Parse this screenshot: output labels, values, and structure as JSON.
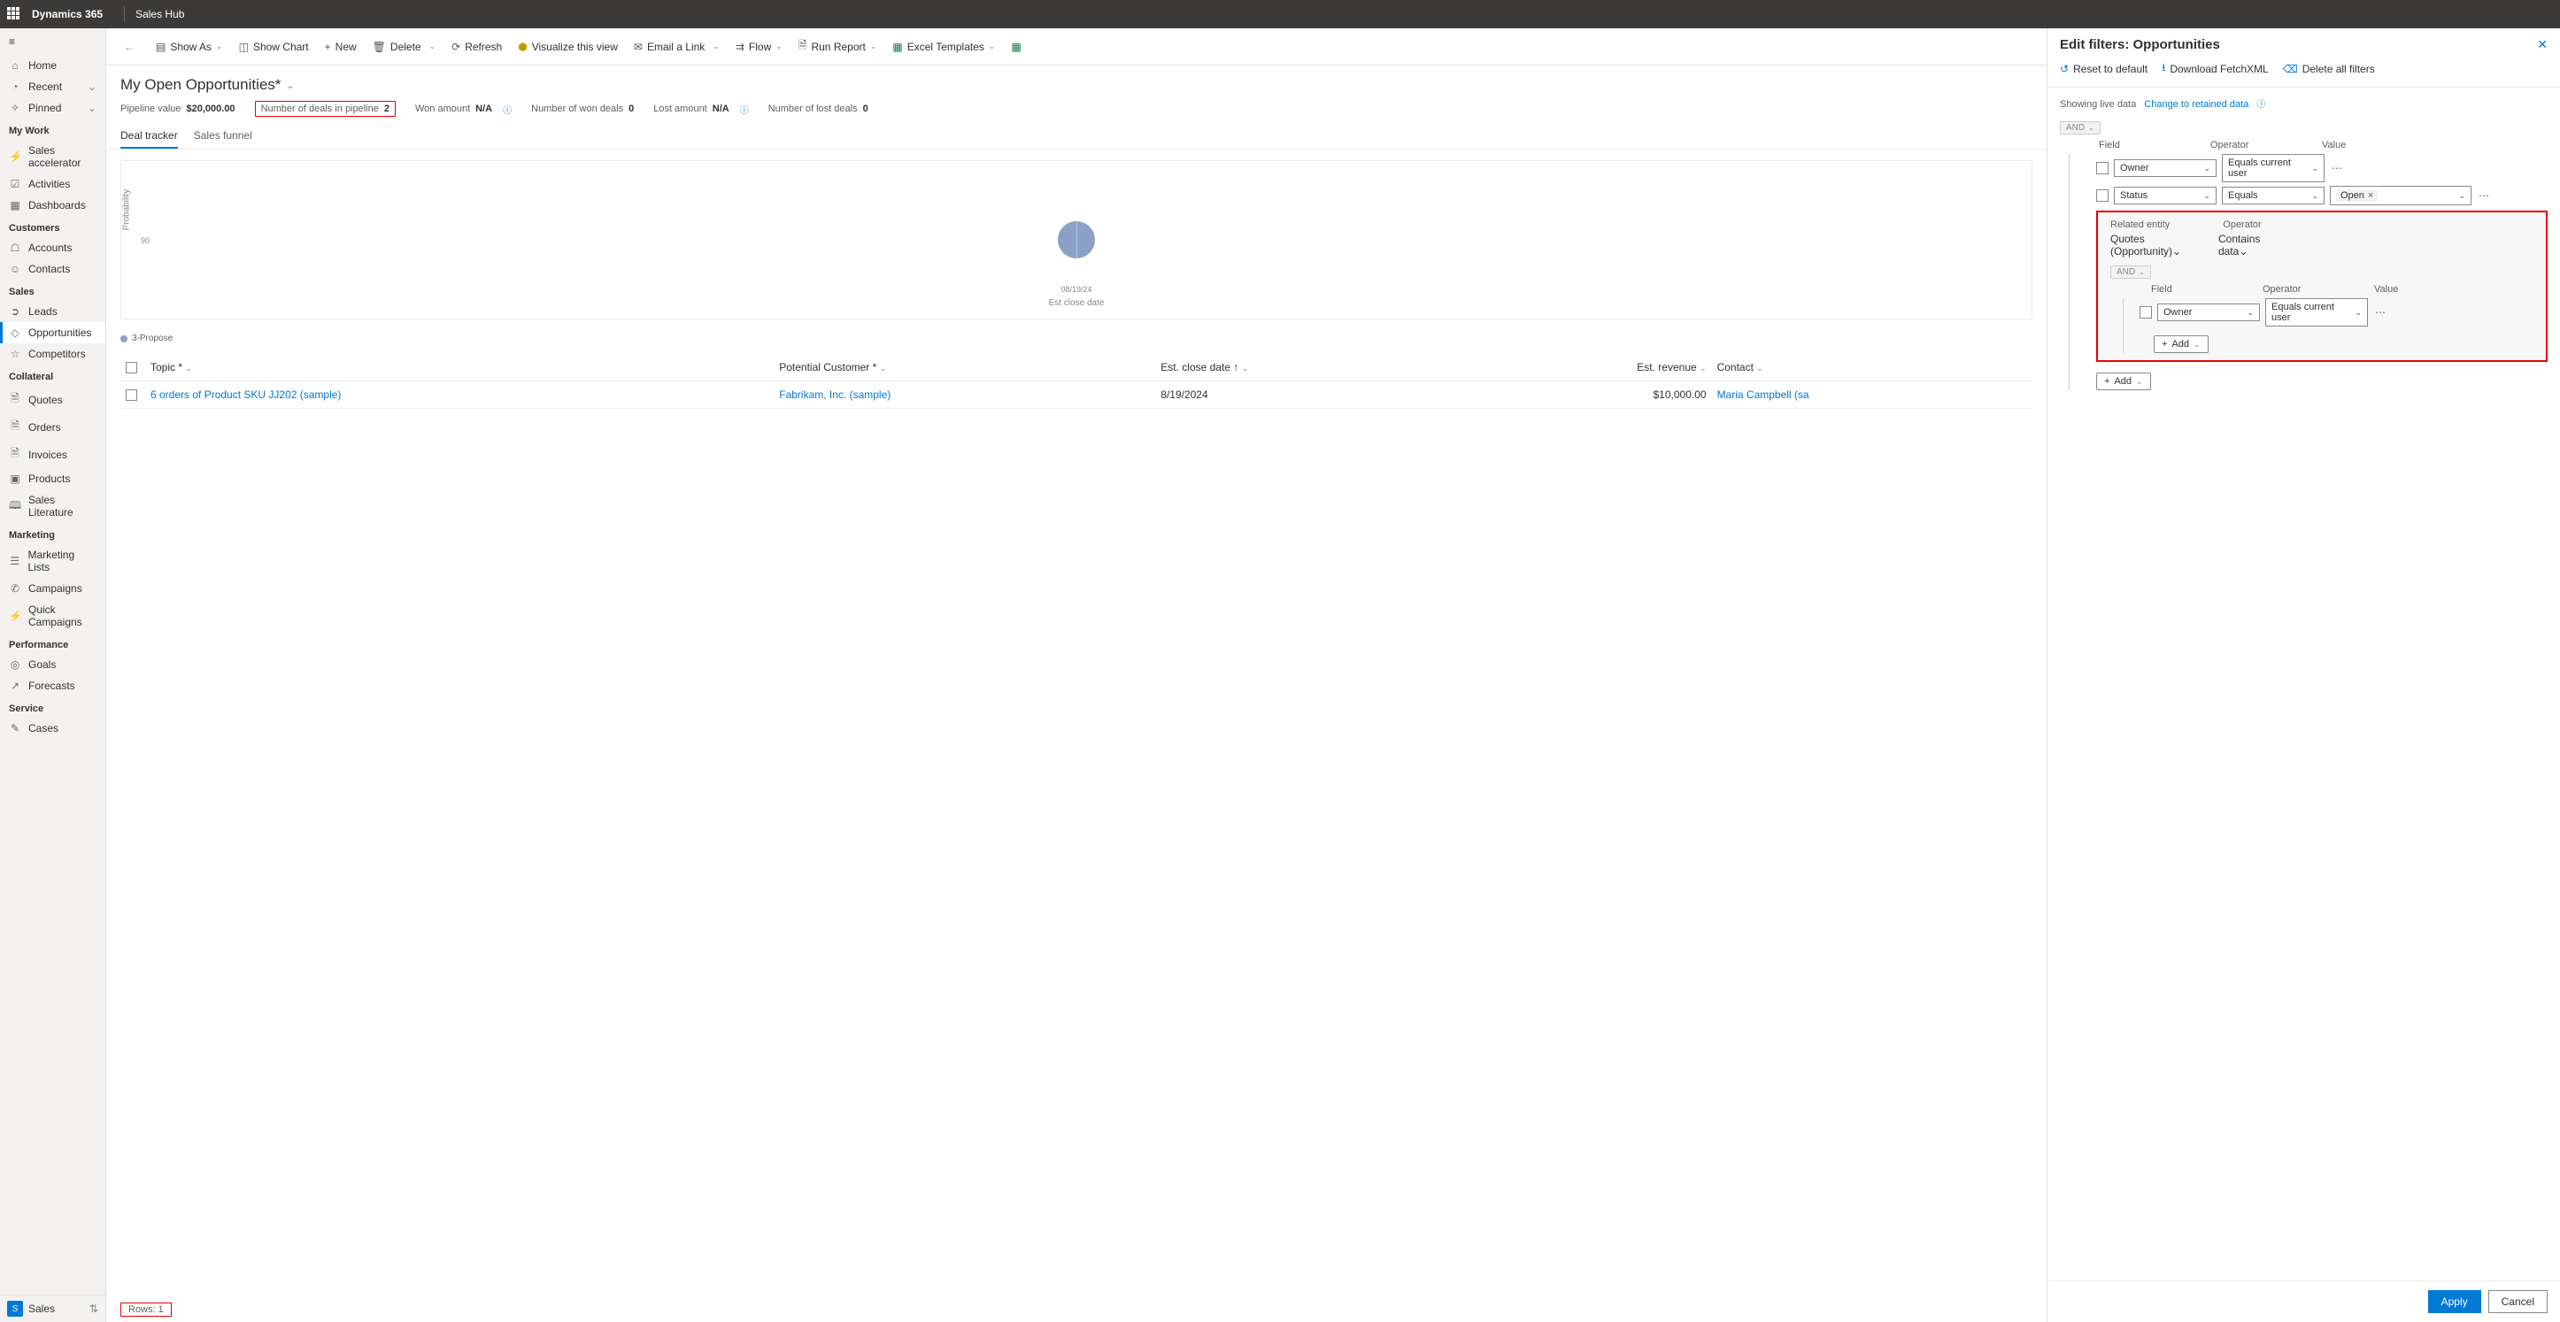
{
  "topbar": {
    "app": "Dynamics 365",
    "area": "Sales Hub"
  },
  "sidebar": {
    "home": "Home",
    "recent": "Recent",
    "pinned": "Pinned",
    "groups": [
      {
        "label": "My Work",
        "items": [
          "Sales accelerator",
          "Activities",
          "Dashboards"
        ]
      },
      {
        "label": "Customers",
        "items": [
          "Accounts",
          "Contacts"
        ]
      },
      {
        "label": "Sales",
        "items": [
          "Leads",
          "Opportunities",
          "Competitors"
        ]
      },
      {
        "label": "Collateral",
        "items": [
          "Quotes",
          "Orders",
          "Invoices",
          "Products",
          "Sales Literature"
        ]
      },
      {
        "label": "Marketing",
        "items": [
          "Marketing Lists",
          "Campaigns",
          "Quick Campaigns"
        ]
      },
      {
        "label": "Performance",
        "items": [
          "Goals",
          "Forecasts"
        ]
      },
      {
        "label": "Service",
        "items": [
          "Cases"
        ]
      }
    ],
    "selected": "Opportunities",
    "area_switch": "Sales"
  },
  "commandbar": {
    "show_as": "Show As",
    "show_chart": "Show Chart",
    "new": "New",
    "delete": "Delete",
    "refresh": "Refresh",
    "visualize": "Visualize this view",
    "email": "Email a Link",
    "flow": "Flow",
    "run_report": "Run Report",
    "excel_tmpl": "Excel Templates"
  },
  "view": {
    "title": "My Open Opportunities*",
    "metrics": {
      "pipeline_value_lbl": "Pipeline value",
      "pipeline_value": "$20,000.00",
      "deals_pipeline_lbl": "Number of deals in pipeline",
      "deals_pipeline": "2",
      "won_amount_lbl": "Won amount",
      "won_amount": "N/A",
      "num_won_lbl": "Number of won deals",
      "num_won": "0",
      "lost_amount_lbl": "Lost amount",
      "lost_amount": "N/A",
      "num_lost_lbl": "Number of lost deals",
      "num_lost": "0"
    },
    "tabs": {
      "deal": "Deal tracker",
      "funnel": "Sales funnel"
    },
    "chart": {
      "ylabel": "Probability",
      "ytick": "90",
      "xlabel": "Est close date",
      "xtick": "08/19/24",
      "legend": "3-Propose"
    },
    "columns": {
      "topic": "Topic *",
      "pcust": "Potential Customer *",
      "ecd": "Est. close date ↑",
      "erev": "Est. revenue",
      "contact": "Contact"
    },
    "rows": [
      {
        "topic": "6 orders of Product SKU JJ202 (sample)",
        "pcust": "Fabrikam, Inc. (sample)",
        "ecd": "8/19/2024",
        "erev": "$10,000.00",
        "contact": "Maria Campbell (sa"
      }
    ],
    "footer_rows_lbl": "Rows:",
    "footer_rows_val": "1"
  },
  "panel": {
    "title": "Edit filters: Opportunities",
    "reset": "Reset to default",
    "fetch": "Download FetchXML",
    "delete_all": "Delete all filters",
    "showing": "Showing live data",
    "change_link": "Change to retained data",
    "conj": "AND",
    "hdr_field": "Field",
    "hdr_op": "Operator",
    "hdr_val": "Value",
    "row1_field": "Owner",
    "row1_op": "Equals current user",
    "row2_field": "Status",
    "row2_op": "Equals",
    "row2_val": "Open",
    "related_lbl": "Related entity",
    "related_op_lbl": "Operator",
    "related_entity": "Quotes (Opportunity)",
    "related_op": "Contains data",
    "nested_conj": "AND",
    "nested_field": "Owner",
    "nested_op": "Equals current user",
    "add": "Add",
    "apply": "Apply",
    "cancel": "Cancel"
  }
}
